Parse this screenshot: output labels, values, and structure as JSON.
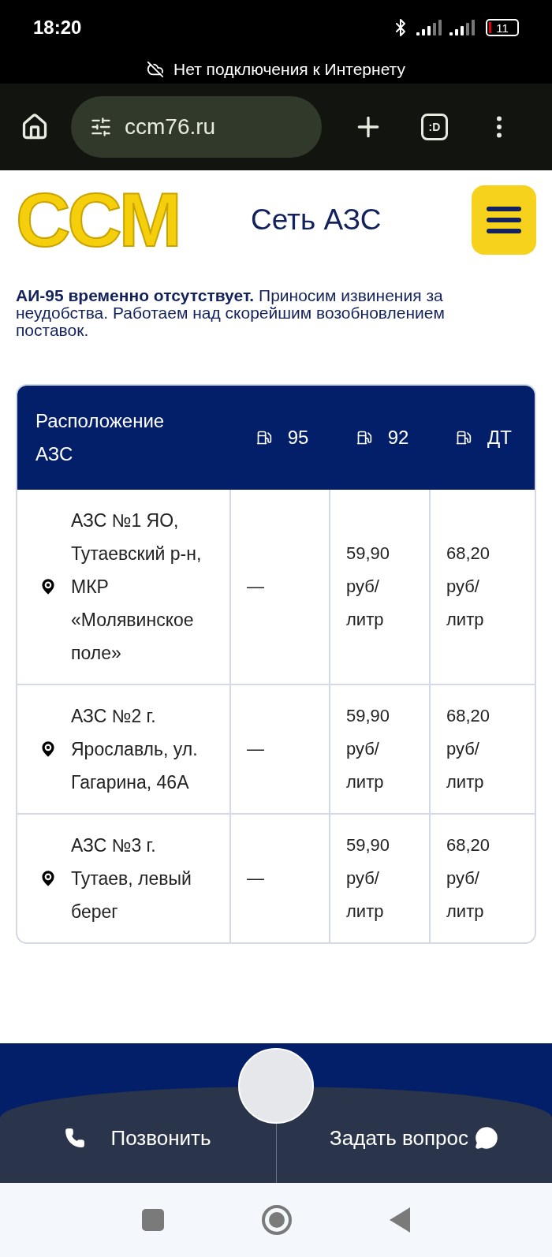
{
  "status_bar": {
    "time": "18:20",
    "battery": "11"
  },
  "offline_banner": "Нет подключения к Интернету",
  "browser": {
    "url": "ccm76.ru",
    "tab_switcher": ":D"
  },
  "header": {
    "logo": "CCM",
    "title": "Сеть АЗС"
  },
  "notice": "**АИ-95 временно отсутствует.** Приносим извинения за неудобства. Работаем над скорейшим возобновлением поставок.",
  "table": {
    "columns": [
      "Расположение АЗС",
      "95",
      "92",
      "ДТ"
    ],
    "rows": [
      {
        "location": "АЗС №1 ЯО, Тутаевский р-н, МКР «Молявинское поле»",
        "price_95": "—",
        "price_92": "59,90 руб/литр",
        "price_dt": "68,20 руб/литр"
      },
      {
        "location": "АЗС №2 г. Ярославль, ул. Гагарина, 46А",
        "price_95": "—",
        "price_92": "59,90 руб/литр",
        "price_dt": "68,20 руб/литр"
      },
      {
        "location": "АЗС №3 г. Тутаев, левый берег",
        "price_95": "—",
        "price_92": "59,90 руб/литр",
        "price_dt": "68,20 руб/литр"
      }
    ]
  },
  "footer": {
    "call": "Позвонить",
    "ask": "Задать вопрос"
  }
}
